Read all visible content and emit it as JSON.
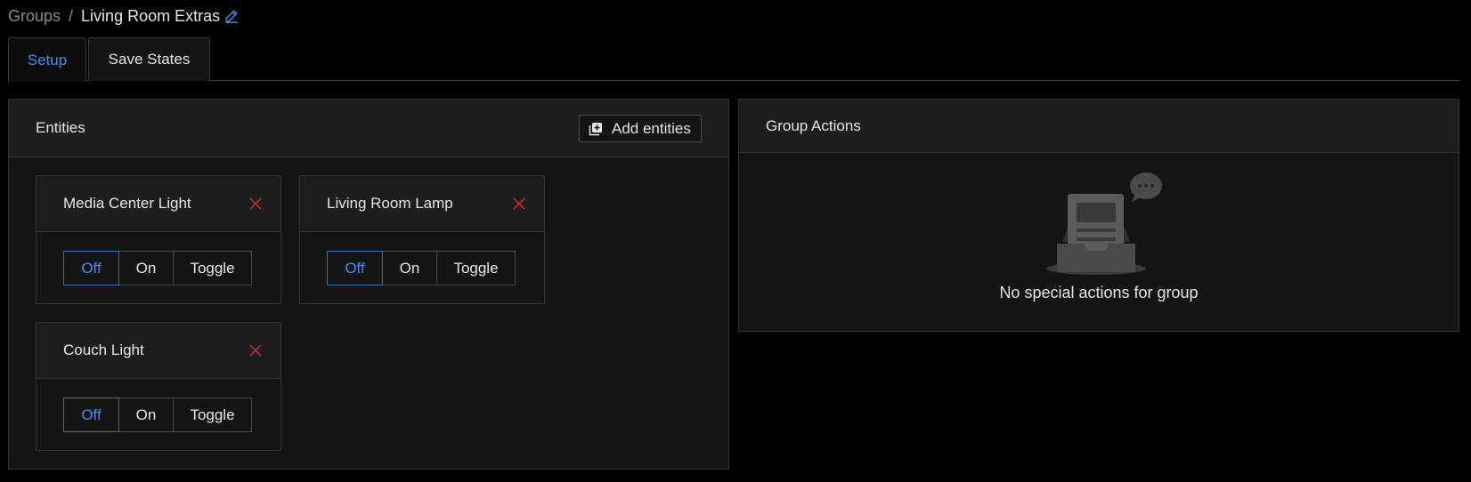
{
  "breadcrumb": {
    "parent": "Groups",
    "separator": "/",
    "current": "Living Room Extras"
  },
  "tabs": [
    {
      "label": "Setup",
      "active": true
    },
    {
      "label": "Save States",
      "active": false
    }
  ],
  "entities_panel": {
    "title": "Entities",
    "add_button_label": "Add entities",
    "entities": [
      {
        "name": "Media Center Light",
        "buttons": [
          "Off",
          "On",
          "Toggle"
        ],
        "selected": "Off"
      },
      {
        "name": "Living Room Lamp",
        "buttons": [
          "Off",
          "On",
          "Toggle"
        ],
        "selected": "Off"
      },
      {
        "name": "Couch Light",
        "buttons": [
          "Off",
          "On",
          "Toggle"
        ],
        "selected": "Off"
      }
    ]
  },
  "actions_panel": {
    "title": "Group Actions",
    "empty_message": "No special actions for group"
  },
  "icons": {
    "edit": "pencil-icon",
    "add": "add-box-icon",
    "remove": "close-icon",
    "empty": "empty-inbox-illustration"
  },
  "colors": {
    "accent": "#3b8eea",
    "remove": "#c0292b",
    "background": "#000000",
    "panel": "#141414",
    "panel_header": "#1d1d1d"
  }
}
